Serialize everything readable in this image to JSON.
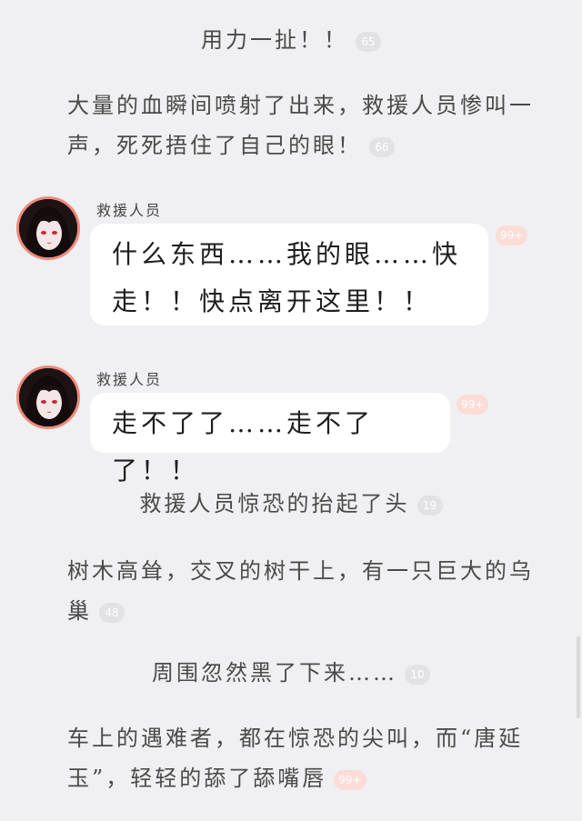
{
  "colors": {
    "background": "#f0f0f2",
    "bubble": "#ffffff",
    "badge": "#e2e2e4",
    "badge_hot": "#fbdcd6",
    "avatar_ring": "#f08a7a"
  },
  "blocks": [
    {
      "type": "narration",
      "text": "用力一扯！！",
      "comment_count": "65"
    },
    {
      "type": "narration",
      "lines": [
        "大量的血瞬间喷射了出来，救援人员惨叫一",
        "声，死死捂住了自己的眼！"
      ],
      "comment_count": "66"
    },
    {
      "type": "dialogue",
      "speaker": "救援人员",
      "avatar": "girl-avatar-icon",
      "lines": [
        "什么东西……我的眼……快",
        "走！！快点离开这里！！"
      ],
      "comment_count": "99+"
    },
    {
      "type": "dialogue",
      "speaker": "救援人员",
      "avatar": "girl-avatar-icon",
      "lines": [
        "走不了了……走不了了！！"
      ],
      "comment_count": "99+"
    },
    {
      "type": "narration",
      "text": "救援人员惊恐的抬起了头",
      "comment_count": "19"
    },
    {
      "type": "narration",
      "lines": [
        "树木高耸，交叉的树干上，有一只巨大的乌",
        "巢"
      ],
      "comment_count": "48"
    },
    {
      "type": "narration",
      "text": "周围忽然黑了下来……",
      "comment_count": "10"
    },
    {
      "type": "narration",
      "lines": [
        "车上的遇难者，都在惊恐的尖叫，而“唐延",
        "玉”，轻轻的舔了舔嘴唇"
      ],
      "comment_count": "99+"
    }
  ]
}
